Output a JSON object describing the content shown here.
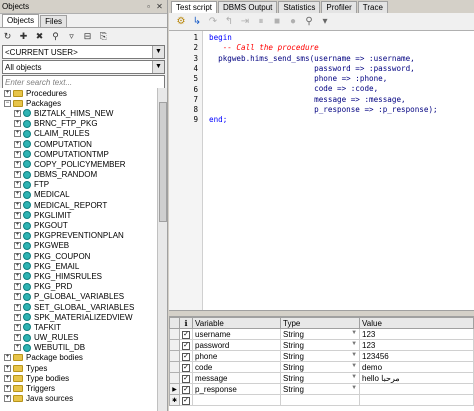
{
  "left_panel": {
    "title": "Objects",
    "tabs": [
      "Objects",
      "Files"
    ],
    "user_combo": "<CURRENT USER>",
    "filter_combo": "All objects",
    "search_placeholder": "Enter search text...",
    "tree": [
      {
        "label": "Procedures",
        "kind": "folder",
        "expander": "+",
        "indent": 0
      },
      {
        "label": "Packages",
        "kind": "folder",
        "expander": "−",
        "indent": 0
      },
      {
        "label": "BIZTALK_HIMS_NEW",
        "kind": "package",
        "expander": "+",
        "indent": 1
      },
      {
        "label": "BRNC_FTP_PKG",
        "kind": "package",
        "expander": "+",
        "indent": 1
      },
      {
        "label": "CLAIM_RULES",
        "kind": "package",
        "expander": "+",
        "indent": 1
      },
      {
        "label": "COMPUTATION",
        "kind": "package",
        "expander": "+",
        "indent": 1
      },
      {
        "label": "COMPUTATIONTMP",
        "kind": "package",
        "expander": "+",
        "indent": 1
      },
      {
        "label": "COPY_POLICYMEMBER",
        "kind": "package",
        "expander": "+",
        "indent": 1
      },
      {
        "label": "DBMS_RANDOM",
        "kind": "package",
        "expander": "+",
        "indent": 1
      },
      {
        "label": "FTP",
        "kind": "package",
        "expander": "+",
        "indent": 1
      },
      {
        "label": "MEDICAL",
        "kind": "package",
        "expander": "+",
        "indent": 1
      },
      {
        "label": "MEDICAL_REPORT",
        "kind": "package",
        "expander": "+",
        "indent": 1
      },
      {
        "label": "PKGLIMIT",
        "kind": "package",
        "expander": "+",
        "indent": 1
      },
      {
        "label": "PKGOUT",
        "kind": "package",
        "expander": "+",
        "indent": 1
      },
      {
        "label": "PKGPREVENTIONPLAN",
        "kind": "package",
        "expander": "+",
        "indent": 1
      },
      {
        "label": "PKGWEB",
        "kind": "package",
        "expander": "+",
        "indent": 1
      },
      {
        "label": "PKG_COUPON",
        "kind": "package",
        "expander": "+",
        "indent": 1
      },
      {
        "label": "PKG_EMAIL",
        "kind": "package",
        "expander": "+",
        "indent": 1
      },
      {
        "label": "PKG_HIMSRULES",
        "kind": "package",
        "expander": "+",
        "indent": 1
      },
      {
        "label": "PKG_PRD",
        "kind": "package",
        "expander": "+",
        "indent": 1
      },
      {
        "label": "P_GLOBAL_VARIABLES",
        "kind": "package",
        "expander": "+",
        "indent": 1
      },
      {
        "label": "SET_GLOBAL_VARIABLES",
        "kind": "package",
        "expander": "+",
        "indent": 1
      },
      {
        "label": "SPK_MATERIALIZEDVIEW",
        "kind": "package",
        "expander": "+",
        "indent": 1
      },
      {
        "label": "TAFKIT",
        "kind": "package",
        "expander": "+",
        "indent": 1
      },
      {
        "label": "UW_RULES",
        "kind": "package",
        "expander": "+",
        "indent": 1
      },
      {
        "label": "WEBUTIL_DB",
        "kind": "package",
        "expander": "+",
        "indent": 1
      },
      {
        "label": "Package bodies",
        "kind": "folder",
        "expander": "+",
        "indent": 0
      },
      {
        "label": "Types",
        "kind": "folder",
        "expander": "+",
        "indent": 0
      },
      {
        "label": "Type bodies",
        "kind": "folder",
        "expander": "+",
        "indent": 0
      },
      {
        "label": "Triggers",
        "kind": "folder",
        "expander": "+",
        "indent": 0
      },
      {
        "label": "Java sources",
        "kind": "folder",
        "expander": "+",
        "indent": 0
      }
    ]
  },
  "right_panel": {
    "tabs": [
      "Test script",
      "DBMS Output",
      "Statistics",
      "Profiler",
      "Trace"
    ],
    "code_lines": [
      {
        "n": "1",
        "parts": [
          {
            "t": "begin",
            "c": "kw"
          }
        ]
      },
      {
        "n": "2",
        "parts": [
          {
            "t": "   -- Call the procedure",
            "c": "cm"
          }
        ]
      },
      {
        "n": "3",
        "parts": [
          {
            "t": "  pkgweb.hims_send_sms(username => :username,",
            "c": "nm"
          }
        ]
      },
      {
        "n": "4",
        "parts": [
          {
            "t": "                       password => :password,",
            "c": "nm"
          }
        ]
      },
      {
        "n": "5",
        "parts": [
          {
            "t": "                       phone => :phone,",
            "c": "nm"
          }
        ]
      },
      {
        "n": "6",
        "parts": [
          {
            "t": "                       code => :code,",
            "c": "nm"
          }
        ]
      },
      {
        "n": "7",
        "parts": [
          {
            "t": "                       message => :message,",
            "c": "nm"
          }
        ]
      },
      {
        "n": "8",
        "parts": [
          {
            "t": "                       p_response => :p_response);",
            "c": "nm"
          }
        ]
      },
      {
        "n": "9",
        "parts": [
          {
            "t": "end;",
            "c": "kw"
          }
        ]
      }
    ],
    "grid": {
      "headers": [
        "Variable",
        "Type",
        "Value"
      ],
      "rows": [
        {
          "variable": "username",
          "type": "String",
          "value": "123"
        },
        {
          "variable": "password",
          "type": "String",
          "value": "123"
        },
        {
          "variable": "phone",
          "type": "String",
          "value": "123456"
        },
        {
          "variable": "code",
          "type": "String",
          "value": "demo"
        },
        {
          "variable": "message",
          "type": "String",
          "value": "hello مرحبا"
        },
        {
          "variable": "p_response",
          "type": "String",
          "value": ""
        },
        {
          "variable": "",
          "type": "",
          "value": ""
        }
      ]
    }
  }
}
